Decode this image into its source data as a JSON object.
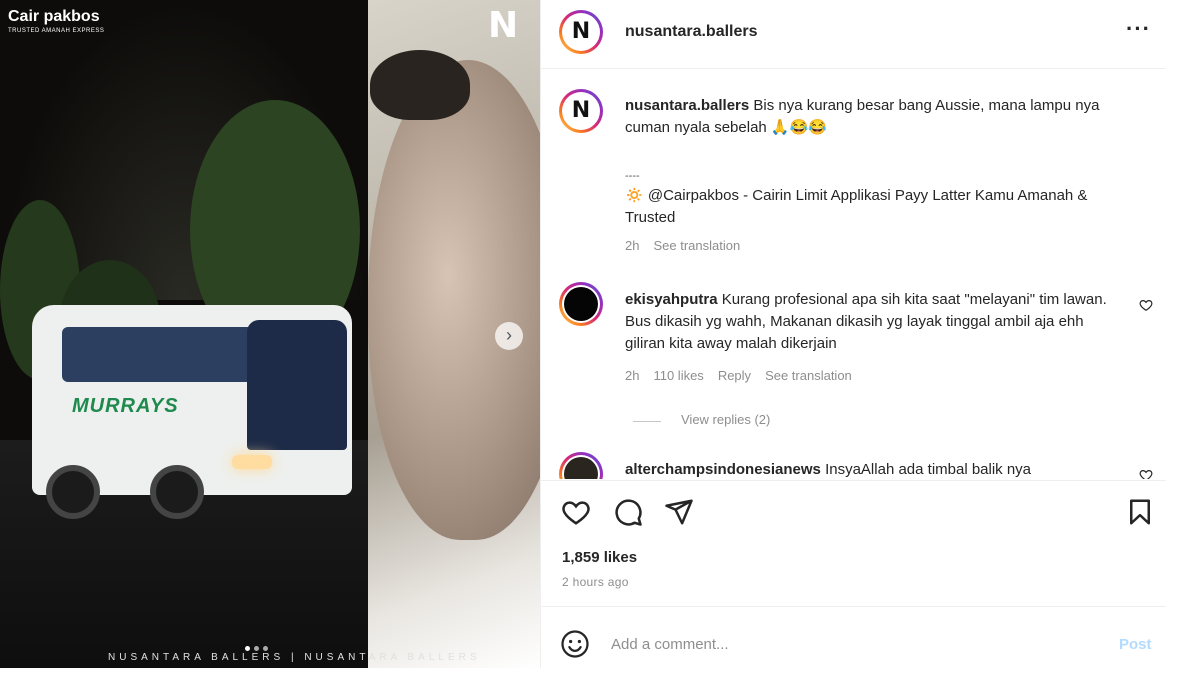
{
  "media": {
    "brand_title": "Cair pakbos",
    "brand_subtitle": "TRUSTED AMANAH EXPRESS",
    "logo_glyph": "N",
    "bus_logo": "MURRAYS",
    "footer_text": "NUSANTARA BALLERS | NUSANTARA BALLERS",
    "next_glyph": "›",
    "slide_count": 3,
    "active_slide": 1
  },
  "header": {
    "username": "nusantara.ballers",
    "more_glyph": "···"
  },
  "caption": {
    "username": "nusantara.ballers",
    "text": "Bis nya kurang besar bang Aussie, mana lampu nya cuman nyala sebelah 🙏😂😂",
    "divider": "----",
    "promo": "🔅 @Cairpakbos - Cairin Limit Applikasi Payy Latter Kamu Amanah & Trusted",
    "time": "2h",
    "translation": "See translation"
  },
  "comments": [
    {
      "username": "ekisyahputra",
      "text": "Kurang profesional apa sih kita saat \"melayani\" tim lawan. Bus dikasih yg wahh, Makanan dikasih yg layak tinggal ambil aja ehh giliran kita away malah dikerjain",
      "time": "2h",
      "likes": "110 likes",
      "reply": "Reply",
      "translation": "See translation",
      "view_replies": "View replies (2)"
    },
    {
      "username": "alterchampsindonesianews",
      "text": "InsyaAllah ada timbal balik nya"
    }
  ],
  "footer": {
    "likes": "1,859 likes",
    "time_ago": "2 hours ago",
    "add_comment_placeholder": "Add a comment...",
    "post_label": "Post"
  }
}
